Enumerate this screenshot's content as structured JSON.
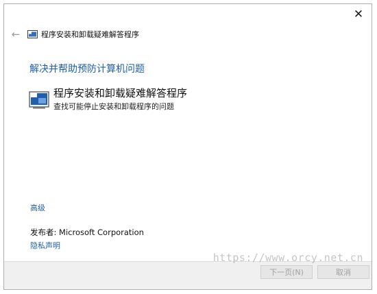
{
  "window": {
    "close_glyph": "✕"
  },
  "header": {
    "back_glyph": "←",
    "title": "程序安装和卸载疑难解答程序"
  },
  "main": {
    "heading": "解决并帮助预防计算机问题",
    "tool": {
      "title": "程序安装和卸载疑难解答程序",
      "description": "查找可能停止安装和卸载程序的问题"
    },
    "advanced_link": "高级",
    "publisher_label": "发布者:",
    "publisher_value": "Microsoft Corporation",
    "privacy_link": "隐私声明"
  },
  "footer": {
    "next_button": "下一页(N)",
    "cancel_button": "取消"
  },
  "watermark": {
    "text": "https://www.orcy.net.cn"
  },
  "colors": {
    "link_blue": "#1e5fa8",
    "footer_bg": "#f0f0f0",
    "disabled_text": "#a0a0a0"
  },
  "icons": {
    "back": "arrow-left-icon",
    "app": "troubleshooter-icon",
    "close": "close-icon"
  }
}
